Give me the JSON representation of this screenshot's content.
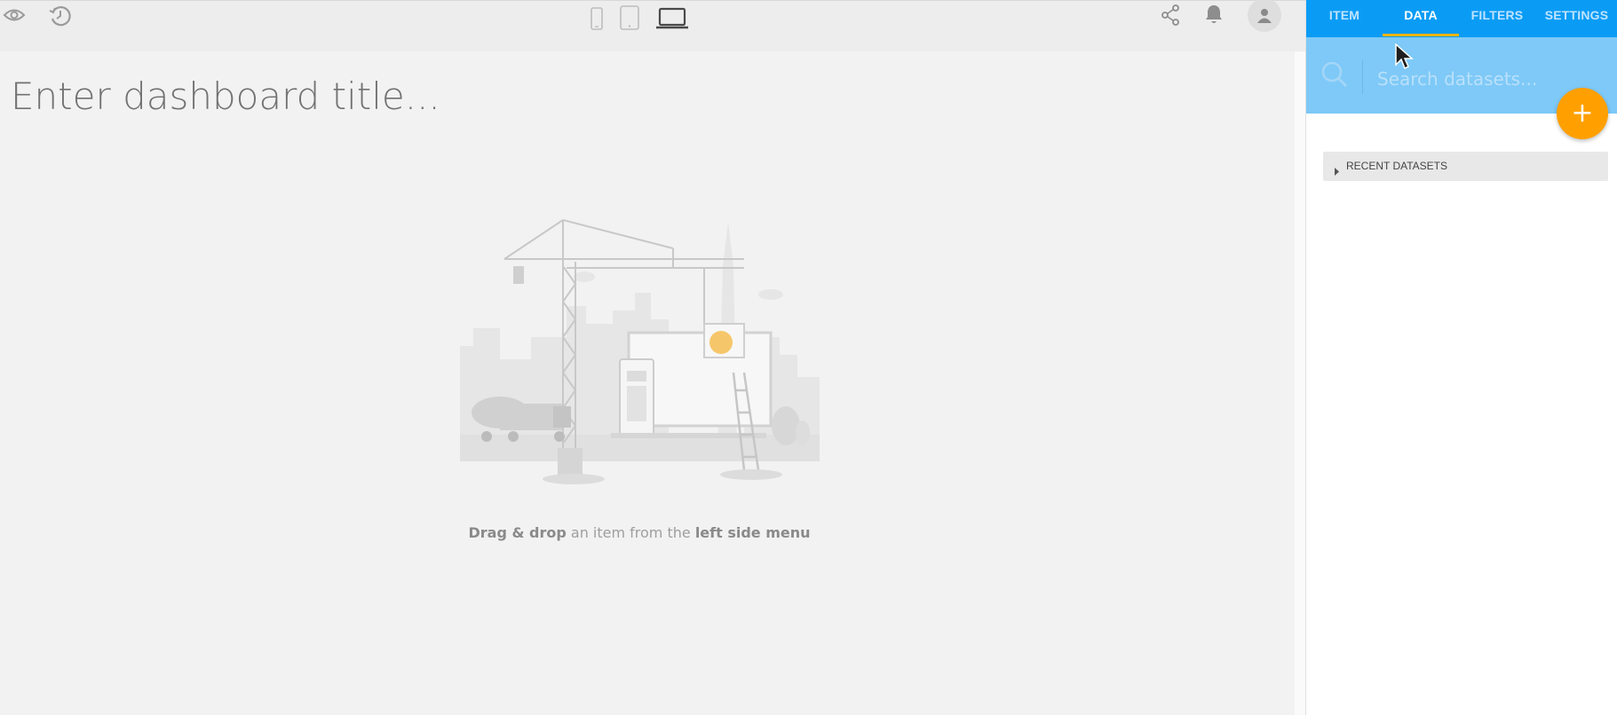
{
  "toolbar": {
    "left_icons": [
      "eye-icon",
      "history-icon"
    ],
    "device_icons": [
      "phone-icon",
      "tablet-icon",
      "laptop-icon"
    ],
    "right_icons": [
      "share-icon",
      "bell-icon",
      "user-avatar-icon"
    ]
  },
  "dashboard": {
    "title_placeholder": "Enter dashboard title...",
    "hint": {
      "strong1": "Drag & drop",
      "mid": " an item from the ",
      "strong2": "left side menu"
    }
  },
  "panel": {
    "tabs": [
      {
        "label": "ITEM",
        "active": false
      },
      {
        "label": "DATA",
        "active": true
      },
      {
        "label": "FILTERS",
        "active": false
      },
      {
        "label": "SETTINGS",
        "active": false
      }
    ],
    "search_placeholder": "Search datasets...",
    "add_button": "+",
    "recent_section_label": "RECENT DATASETS"
  },
  "colors": {
    "tab_bar": "#0a9cf5",
    "search_bar": "#7ec9f7",
    "accent_underline": "#f0b400",
    "fab": "#ffa000"
  }
}
